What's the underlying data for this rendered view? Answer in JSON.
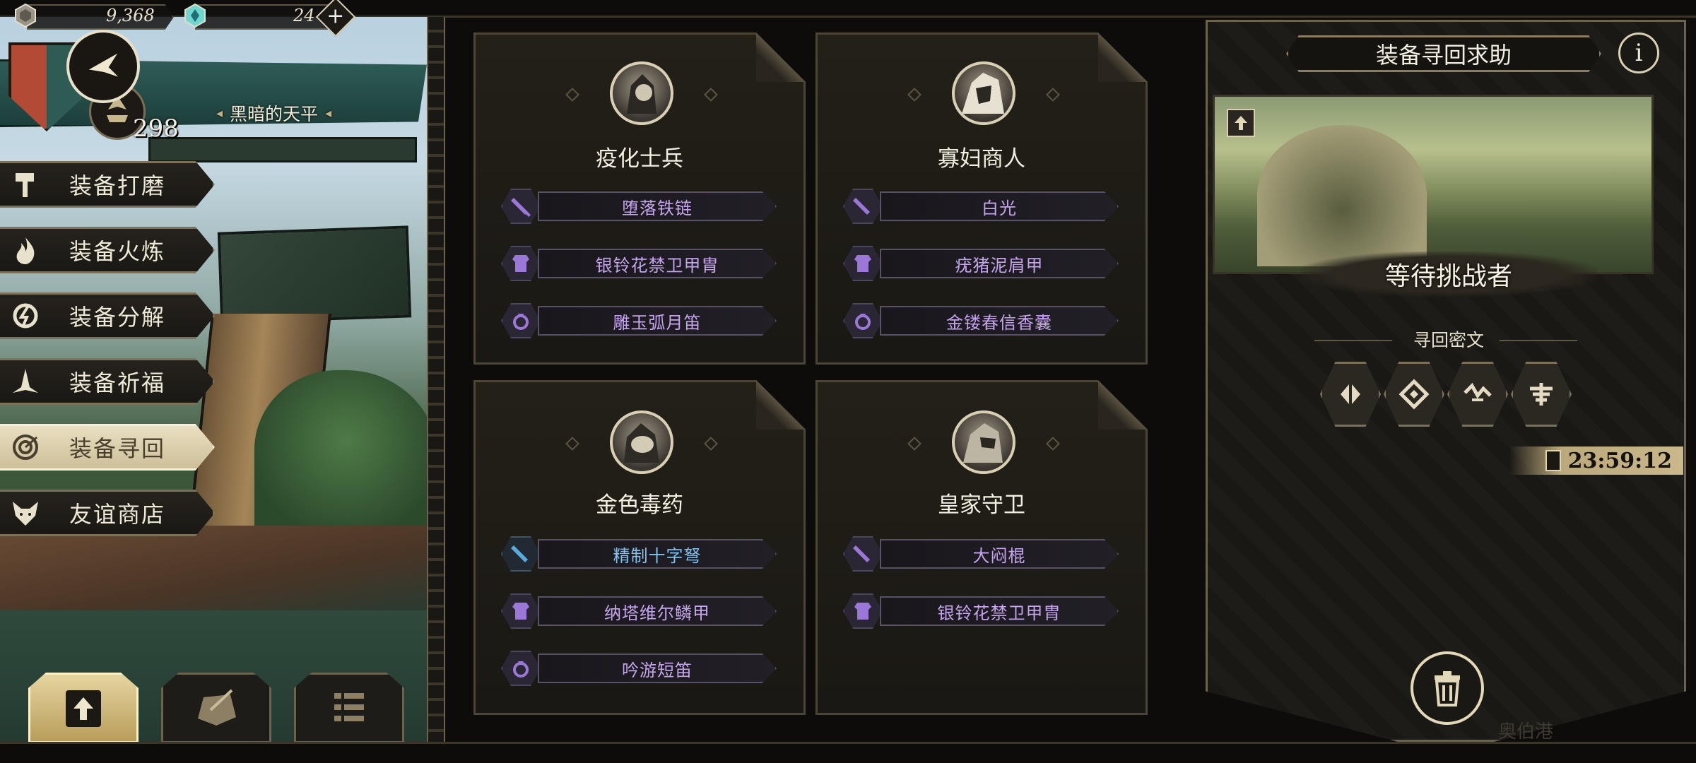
{
  "resources": {
    "coins": "9,368",
    "gems": "24",
    "plus_symbol": "+"
  },
  "player": {
    "level": "298",
    "scale_title": "黑暗的天平",
    "title_ornament": "◂"
  },
  "menu": [
    {
      "label": "装备打磨",
      "icon": "hammer-icon",
      "active": false
    },
    {
      "label": "装备火炼",
      "icon": "flame-icon",
      "active": false
    },
    {
      "label": "装备分解",
      "icon": "decompose-icon",
      "active": false
    },
    {
      "label": "装备祈福",
      "icon": "pray-icon",
      "active": false
    },
    {
      "label": "装备寻回",
      "icon": "target-icon",
      "active": true
    },
    {
      "label": "友谊商店",
      "icon": "fox-icon",
      "active": false
    }
  ],
  "cards": [
    {
      "name": "疫化士兵",
      "items": [
        {
          "label": "堕落铁链",
          "icon": "sword-icon",
          "color": "purple"
        },
        {
          "label": "银铃花禁卫甲胄",
          "icon": "armor-icon",
          "color": "purple"
        },
        {
          "label": "雕玉弧月笛",
          "icon": "ring-icon",
          "color": "purple"
        }
      ]
    },
    {
      "name": "寡妇商人",
      "items": [
        {
          "label": "白光",
          "icon": "sword-icon",
          "color": "purple"
        },
        {
          "label": "疣猪泥肩甲",
          "icon": "armor-icon",
          "color": "purple"
        },
        {
          "label": "金镂春信香囊",
          "icon": "ring-icon",
          "color": "purple"
        }
      ]
    },
    {
      "name": "金色毒药",
      "items": [
        {
          "label": "精制十字弩",
          "icon": "sword-icon",
          "color": "blue"
        },
        {
          "label": "纳塔维尔鳞甲",
          "icon": "armor-icon",
          "color": "purple"
        },
        {
          "label": "吟游短笛",
          "icon": "ring-icon",
          "color": "purple"
        }
      ]
    },
    {
      "name": "皇家守卫",
      "items": [
        {
          "label": "大闷棍",
          "icon": "sword-icon",
          "color": "purple"
        },
        {
          "label": "银铃花禁卫甲胄",
          "icon": "armor-icon",
          "color": "purple"
        }
      ]
    }
  ],
  "right": {
    "title": "装备寻回求助",
    "info": "i",
    "status": "等待挑战者",
    "cipher_label": "寻回密文",
    "timer": "23:59:12",
    "ghost_text": "奥伯港"
  },
  "colors": {
    "item_purple": "#c6a5ee",
    "item_blue": "#7fc1ef",
    "gold": "#d9cfb3"
  }
}
